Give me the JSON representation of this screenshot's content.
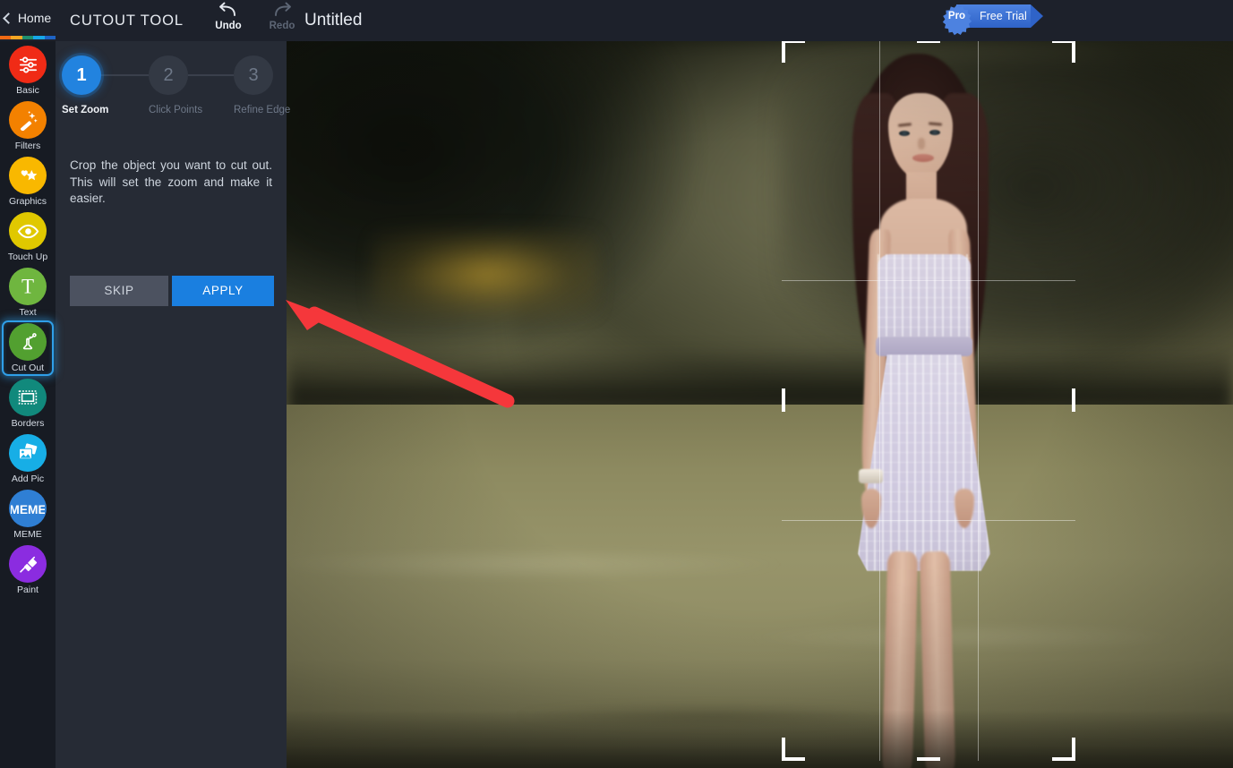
{
  "topbar": {
    "home_label": "Home",
    "home_strip_colors": [
      "#f06a14",
      "#f5a623",
      "#1f8f6e",
      "#16a7e8",
      "#1e63c4"
    ],
    "tool_title": "CUTOUT TOOL",
    "undo_label": "Undo",
    "redo_label": "Redo",
    "document_title": "Untitled",
    "pro_badge_label": "Pro",
    "free_trial_label": "Free Trial",
    "accent_blue": "#2283df"
  },
  "sidebar": {
    "items": [
      {
        "label": "Basic",
        "icon": "sliders-icon",
        "color": "#f02b16"
      },
      {
        "label": "Filters",
        "icon": "magic-wand-icon",
        "color": "#f38100"
      },
      {
        "label": "Graphics",
        "icon": "star-heart-icon",
        "color": "#f9b800"
      },
      {
        "label": "Touch Up",
        "icon": "eye-icon",
        "color": "#e0c800"
      },
      {
        "label": "Text",
        "icon": "text-t-icon",
        "color": "#6fb63f"
      },
      {
        "label": "Cut Out",
        "icon": "scissors-cut-icon",
        "color": "#52a030",
        "active": true
      },
      {
        "label": "Borders",
        "icon": "frame-icon",
        "color": "#11897c"
      },
      {
        "label": "Add Pic",
        "icon": "photos-icon",
        "color": "#17aee6"
      },
      {
        "label": "MEME",
        "icon": "meme-icon",
        "color": "#2f7fd4"
      },
      {
        "label": "Paint",
        "icon": "paintbrush-icon",
        "color": "#8b2ce0"
      }
    ]
  },
  "panel": {
    "steps": [
      {
        "number": "1",
        "caption": "Set Zoom",
        "state": "done"
      },
      {
        "number": "2",
        "caption": "Click Points",
        "state": "todo"
      },
      {
        "number": "3",
        "caption": "Refine Edge",
        "state": "todo"
      }
    ],
    "instructions": "Crop the object you want to cut out. This will set the zoom and make it easier.",
    "skip_label": "SKIP",
    "apply_label": "APPLY"
  },
  "canvas": {
    "crop_overlay": {
      "handles": [
        "top-left",
        "top-center",
        "top-right",
        "middle-left",
        "middle-right",
        "bottom-left",
        "bottom-center",
        "bottom-right"
      ],
      "grid": "rule-of-thirds"
    },
    "annotation": {
      "type": "arrow",
      "color": "#f5373b",
      "points_to": "apply-button"
    }
  }
}
